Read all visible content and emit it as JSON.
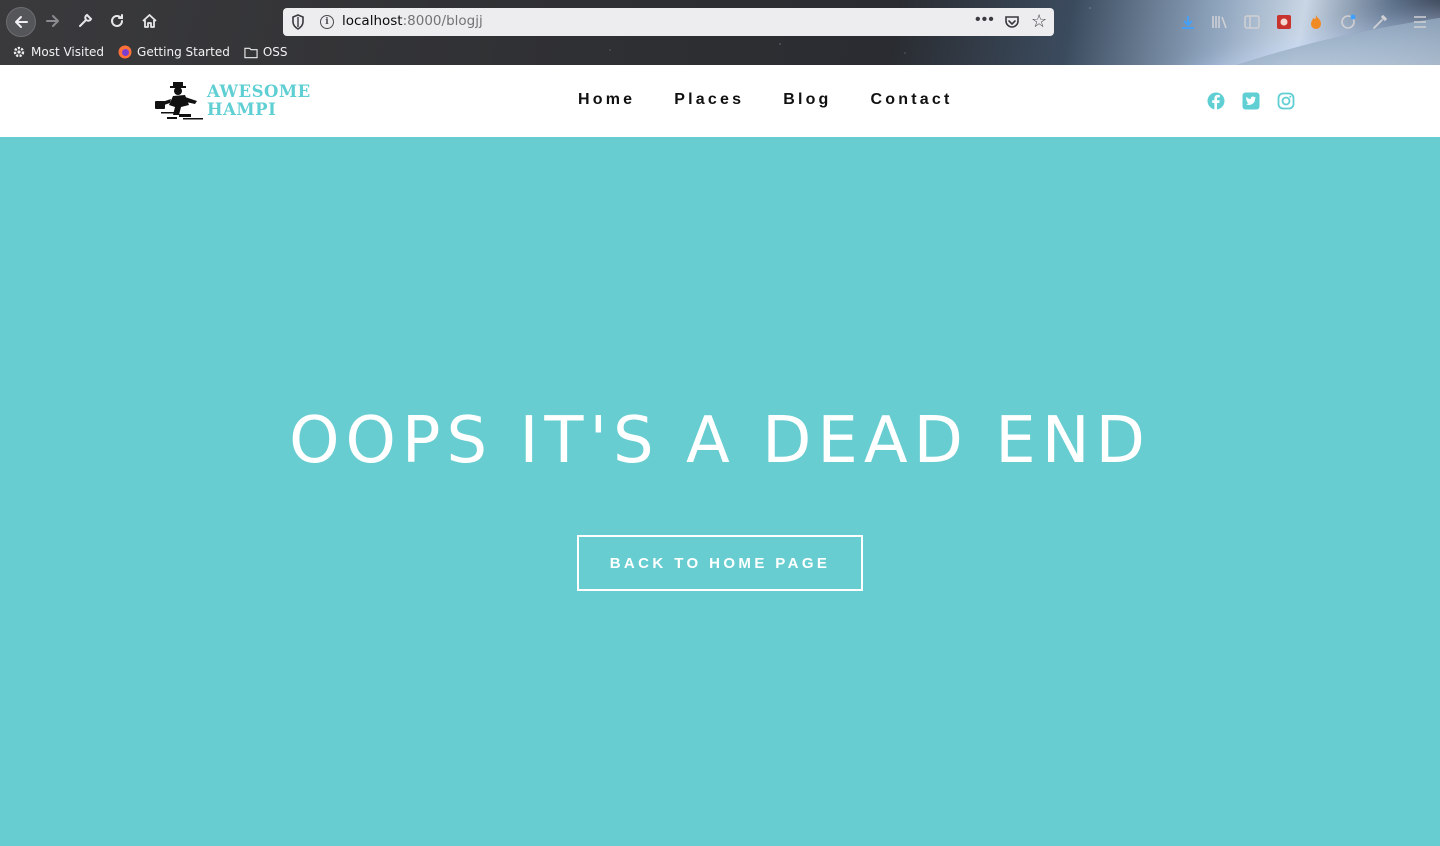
{
  "browser": {
    "url_host": "localhost",
    "url_path": ":8000/blogjj",
    "more_label": "•••",
    "bookmarks": [
      {
        "label": "Most Visited",
        "icon": "gear-icon"
      },
      {
        "label": "Getting Started",
        "icon": "firefox-icon"
      },
      {
        "label": "OSS",
        "icon": "folder-icon"
      }
    ]
  },
  "site": {
    "logo_line1": "AWESOME",
    "logo_line2": "HAMPI",
    "nav": [
      "Home",
      "Places",
      "Blog",
      "Contact"
    ],
    "social": [
      "facebook-icon",
      "twitter-icon",
      "instagram-icon"
    ],
    "accent_color": "#5fcfd3"
  },
  "hero": {
    "title": "OOPS IT'S A DEAD END",
    "button_label": "BACK TO HOME PAGE",
    "background_color": "#67cdd0"
  }
}
